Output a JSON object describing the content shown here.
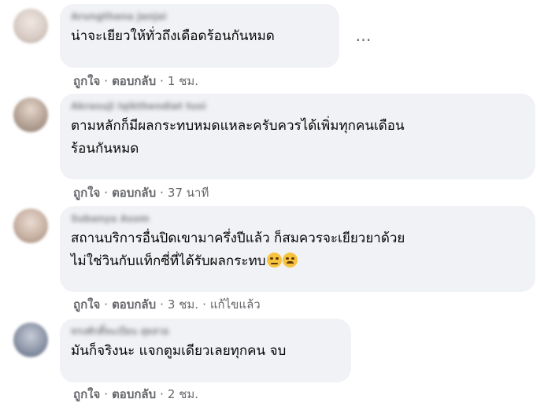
{
  "comments": [
    {
      "author": "Arungthana Janjai",
      "lines": [
        "น่าจะเยียวให้ทั่วถึงเดือดร้อนกันหมด"
      ],
      "like": "ถูกใจ",
      "reply": "ตอบกลับ",
      "time": "1 ชม.",
      "more": "…",
      "avatar_color": "#d9cdc6"
    },
    {
      "author": "Akrasuji Iqikthendiat tusi",
      "lines": [
        "ตามหลักก็มีผลกระทบหมดแหละครับควรได้เพิ่มทุกคนเดือน",
        "ร้อนกันหมด"
      ],
      "like": "ถูกใจ",
      "reply": "ตอบกลับ",
      "time": "37 นาที",
      "avatar_color": "#b9a79a"
    },
    {
      "author": "Subanya Asom",
      "lines": [
        "สถานบริการอื่นปิดเขามาครึ่งปีแล้ว ก็สมควรจะเยียวยาด้วย",
        "ไม่ใช่วินกับแท็กซี่ที่ได้รับผลกระทบ"
      ],
      "emojis": [
        "smirk-emoji",
        "angry-emoji"
      ],
      "like": "ถูกใจ",
      "reply": "ตอบกลับ",
      "time": "3 ชม.",
      "edited": "แก้ไขแล้ว",
      "avatar_color": "#c8b2a4"
    },
    {
      "author": "ทรงศักดิ์ทะเบียน สุดสวย",
      "lines": [
        "มันก็จริงนะ แจกตูมเดียวเลยทุกคน จบ"
      ],
      "like": "ถูกใจ",
      "reply": "ตอบกลับ",
      "time": "2 ชม.",
      "avatar_color": "#8d96a8"
    }
  ]
}
